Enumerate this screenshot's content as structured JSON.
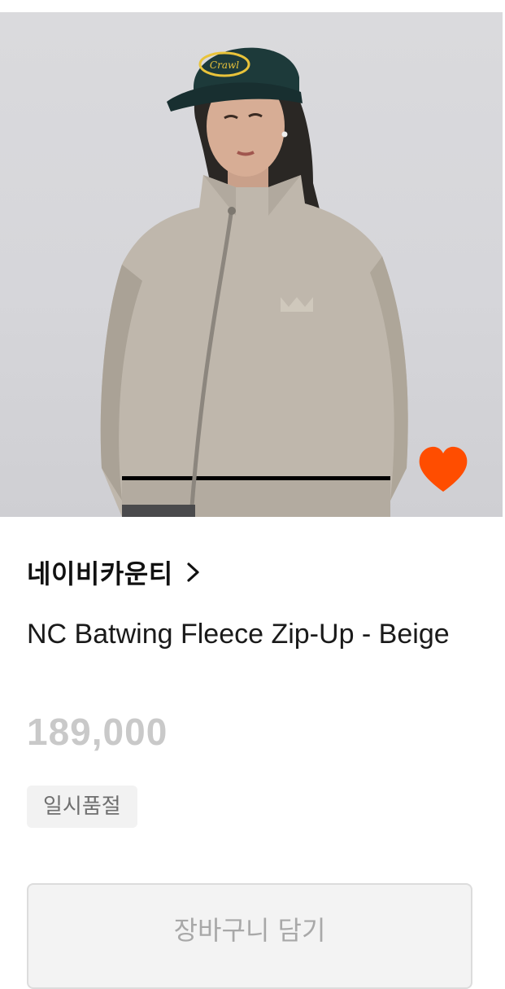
{
  "product": {
    "image_alt": "NC Batwing Fleece Zip-Up - Beige",
    "cap_logo_text": "Crawl",
    "brand": "네이비카운티",
    "name": "NC Batwing Fleece Zip-Up - Beige",
    "price": "189,000",
    "status": "일시품절",
    "wishlisted": true
  },
  "actions": {
    "cart_label": "장바구니 담기"
  },
  "colors": {
    "heart": "#ff4d00",
    "price": "#c9c9c9",
    "badge_bg": "#f2f2f2",
    "badge_text": "#6f6f6f",
    "button_bg": "#f3f3f3",
    "button_text": "#a8a8a8"
  },
  "icons": {
    "wishlist": "heart-icon",
    "brand_link": "chevron-right-icon"
  }
}
